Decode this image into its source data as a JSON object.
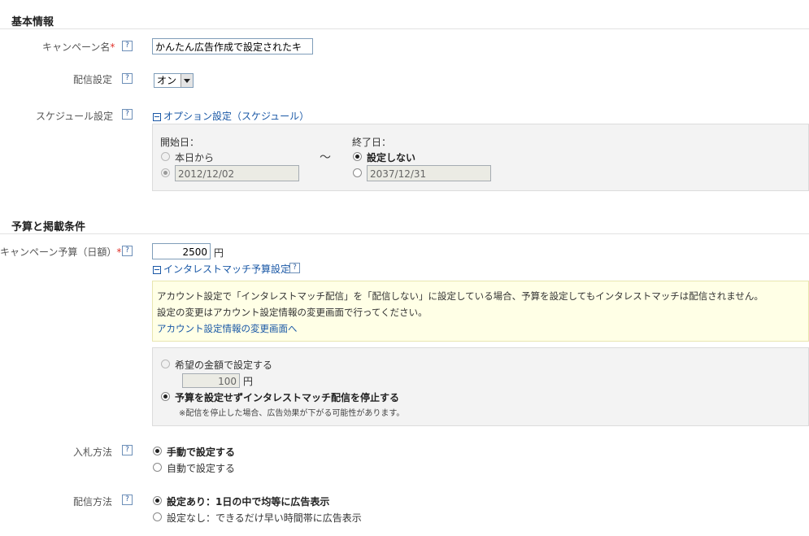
{
  "sections": {
    "basic_info": "基本情報",
    "budget": "予算と掲載条件"
  },
  "campaign_name": {
    "label": "キャンペーン名",
    "required_mark": "*",
    "value": "かんたん広告作成で設定されたキャ"
  },
  "delivery_setting": {
    "label": "配信設定",
    "selected": "オン"
  },
  "schedule": {
    "label": "スケジュール設定",
    "toggle_label": "オプション設定（スケジュール）",
    "start_label": "開始日：",
    "start_today": "本日から",
    "start_date": "2012/12/02",
    "tilde": "～",
    "end_label": "終了日：",
    "end_none": "設定しない",
    "end_date": "2037/12/31"
  },
  "daily_budget": {
    "label": "キャンペーン予算（日額）",
    "required_mark": "*",
    "value": "2500",
    "unit": "円",
    "interstream_toggle": "インタレストマッチ予算設定"
  },
  "notice": {
    "line1": "アカウント設定で「インタレストマッチ配信」を「配信しない」に設定している場合、予算を設定してもインタレストマッチは配信されません。",
    "line2": "設定の変更はアカウント設定情報の変更画面で行ってください。",
    "link": "アカウント設定情報の変更画面へ"
  },
  "interest_budget": {
    "option_amount": "希望の金額で設定する",
    "amount_value": "100",
    "unit": "円",
    "option_stop": "予算を設定せずインタレストマッチ配信を停止する",
    "note": "※配信を停止した場合、広告効果が下がる可能性があります。"
  },
  "bid_method": {
    "label": "入札方法",
    "manual": "手動で設定する",
    "auto": "自動で設定する"
  },
  "delivery_method": {
    "label": "配信方法",
    "even": "設定あり：1日の中で均等に広告表示",
    "fast": "設定なし：できるだけ早い時間帯に広告表示"
  },
  "help_glyph": "?"
}
